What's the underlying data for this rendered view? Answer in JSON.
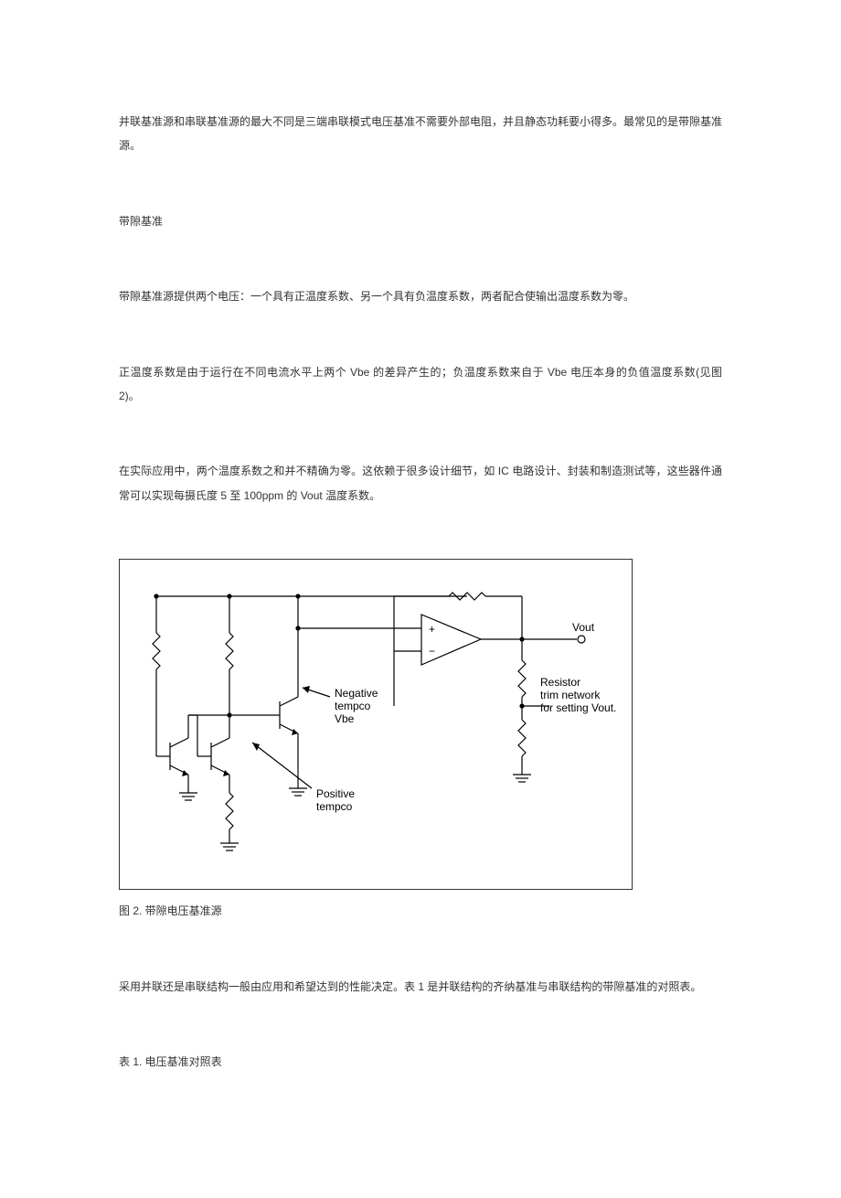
{
  "paragraphs": {
    "p1": "并联基准源和串联基准源的最大不同是三端串联模式电压基准不需要外部电阻，并且静态功耗要小得多。最常见的是带隙基准源。",
    "h1": "带隙基准",
    "p2": "带隙基准源提供两个电压：一个具有正温度系数、另一个具有负温度系数，两者配合使输出温度系数为零。",
    "p3": "正温度系数是由于运行在不同电流水平上两个 Vbe 的差异产生的；负温度系数来自于 Vbe 电压本身的负值温度系数(见图 2)。",
    "p4": "在实际应用中，两个温度系数之和并不精确为零。这依赖于很多设计细节，如 IC 电路设计、封装和制造测试等，这些器件通常可以实现每摄氏度 5 至 100ppm 的 Vout 温度系数。",
    "figcaption": "图 2. 带隙电压基准源",
    "p5": "采用并联还是串联结构一般由应用和希望达到的性能决定。表 1 是并联结构的齐纳基准与串联结构的带隙基准的对照表。",
    "p6": "表 1. 电压基准对照表"
  },
  "figure": {
    "label_vout": "Vout",
    "label_neg": "Negative\ntempco\nVbe",
    "label_pos": "Positive\ntempco",
    "label_resistor": "Resistor\ntrim network\nfor setting Vout."
  }
}
